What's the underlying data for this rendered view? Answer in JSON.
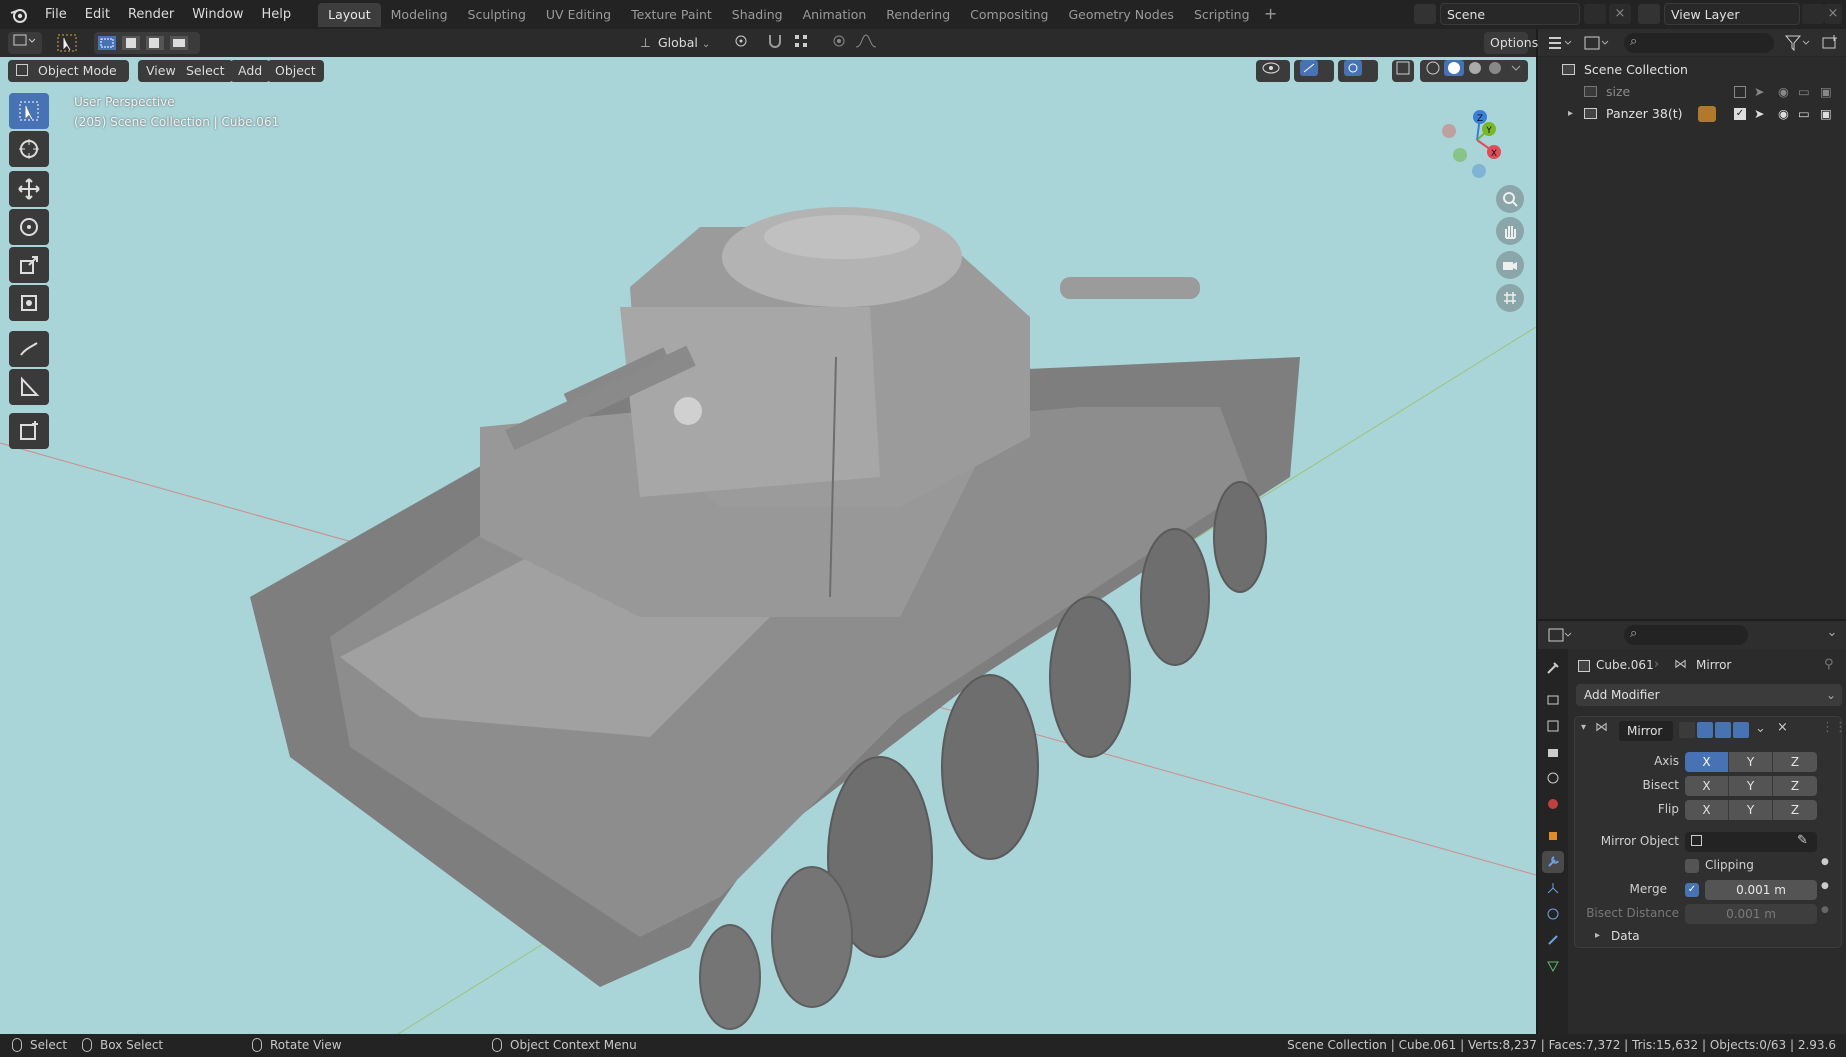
{
  "menu": [
    "File",
    "Edit",
    "Render",
    "Window",
    "Help"
  ],
  "workspaces": [
    "Layout",
    "Modeling",
    "Sculpting",
    "UV Editing",
    "Texture Paint",
    "Shading",
    "Animation",
    "Rendering",
    "Compositing",
    "Geometry Nodes",
    "Scripting"
  ],
  "active_workspace": "Layout",
  "scene_name": "Scene",
  "view_layer": "View Layer",
  "viewport": {
    "mode": "Object Mode",
    "menus": [
      "View",
      "Select",
      "Add",
      "Object"
    ],
    "transform_orientation": "Global",
    "options_label": "Options",
    "perspective_label": "User Perspective",
    "collection_label": "(205) Scene Collection | Cube.061",
    "gizmo_axes": {
      "x": "X",
      "y": "Y",
      "z": "Z"
    },
    "axis_colors": {
      "x": "#e24b5a",
      "y": "#77b82a",
      "z": "#3a7fd6"
    },
    "background_color": "#a9d4d8"
  },
  "outliner": {
    "root": "Scene Collection",
    "items": [
      {
        "name": "size"
      },
      {
        "name": "Panzer 38(t)"
      }
    ]
  },
  "properties": {
    "object_name": "Cube.061",
    "modifier_name_crumb": "Mirror",
    "add_modifier_label": "Add Modifier",
    "modifier": {
      "name": "Mirror",
      "axis_label": "Axis",
      "bisect_label": "Bisect",
      "flip_label": "Flip",
      "axes": [
        "X",
        "Y",
        "Z"
      ],
      "axis_enabled": [
        true,
        false,
        false
      ],
      "mirror_object_label": "Mirror Object",
      "clipping_label": "Clipping",
      "clipping_enabled": false,
      "merge_label": "Merge",
      "merge_enabled": true,
      "merge_value": "0.001 m",
      "bisect_distance_label": "Bisect Distance",
      "bisect_distance_value": "0.001 m",
      "data_label": "Data"
    }
  },
  "statusbar": {
    "select": "Select",
    "box_select": "Box Select",
    "rotate_view": "Rotate View",
    "context_menu": "Object Context Menu",
    "stats": "Scene Collection | Cube.061 | Verts:8,237 | Faces:7,372 | Tris:15,632 | Objects:0/63 | 2.93.6"
  },
  "accent_color": "#4772b3"
}
